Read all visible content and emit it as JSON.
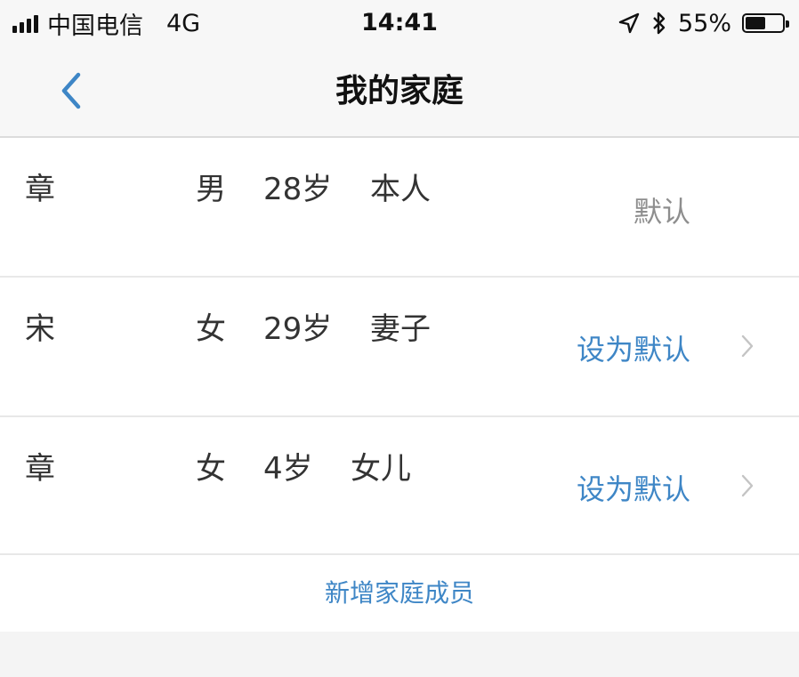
{
  "status_bar": {
    "carrier": "中国电信",
    "network": "4G",
    "time": "14:41",
    "battery": "55%",
    "battery_level": 0.55,
    "icons": [
      "signal-icon",
      "location-arrow-icon",
      "bluetooth-icon",
      "battery-icon"
    ]
  },
  "nav": {
    "title": "我的家庭",
    "back_icon": "chevron-left-icon"
  },
  "members": [
    {
      "name": "章",
      "gender": "男",
      "age": "28岁",
      "relation": "本人",
      "status": "默认"
    },
    {
      "name": "宋",
      "gender": "女",
      "age": "29岁",
      "relation": "妻子",
      "action": "设为默认"
    },
    {
      "name": "章",
      "gender": "女",
      "age": "4岁",
      "relation": "女儿",
      "action": "设为默认"
    }
  ],
  "add_member": {
    "label": "新增家庭成员"
  },
  "colors": {
    "accent": "#3e86c6",
    "nav_background": "#f7f7f7",
    "page_background": "#f4f4f4",
    "text": "#333333",
    "muted": "#8e8e8e"
  }
}
